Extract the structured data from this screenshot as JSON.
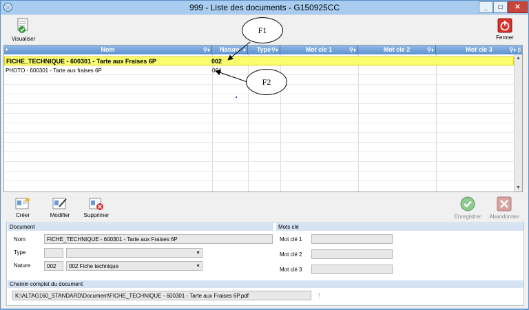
{
  "window": {
    "title": "999 - Liste des documents - G150925CC"
  },
  "toolbar_top": {
    "visualiser": "Visualiser",
    "fermer": "Fermer"
  },
  "grid": {
    "columns": [
      "Nom",
      "Nature",
      "Type",
      "Mot cle 1",
      "Mot cle 2",
      "Mot cle 3"
    ],
    "rows": [
      {
        "nom": "FICHE_TECHNIQUE - 600301 - Tarte aux Fraises 6P",
        "nature": "002",
        "selected": true
      },
      {
        "nom": "PHOTO - 600301 - Tarte aux fraises 6P",
        "nature": "004",
        "selected": false
      }
    ]
  },
  "annotations": {
    "f1": "F1",
    "f2": "F2"
  },
  "toolbar_bottom": {
    "creer": "Créer",
    "modifier": "Modifier",
    "supprimer": "Supprimer",
    "enregistrer": "Enregistrer",
    "abandonner": "Abandonner"
  },
  "form": {
    "document_title": "Document",
    "nom_label": "Nom",
    "nom_value": "FICHE_TECHNIQUE - 600301 - Tarte aux Fraises 6P",
    "type_label": "Type",
    "type_code": "",
    "type_value": "",
    "nature_label": "Nature",
    "nature_code": "002",
    "nature_value": "002  Fiche technique",
    "motscle_title": "Mots clé",
    "motcle1_label": "Mot clé 1",
    "motcle2_label": "Mot clé 2",
    "motcle3_label": "Mot clé 3",
    "motcle1_value": "",
    "motcle2_value": "",
    "motcle3_value": "",
    "chemin_title": "Chemin complet du document",
    "chemin_value": "K:\\ALTAG160_STANDARD\\Document\\FICHE_TECHNIQUE - 600301 - Tarte aux Fraises 6P.pdf"
  },
  "colors": {
    "title_bar": "#a9cdf0",
    "grid_header": "#5e92cf",
    "selected_row": "#fafd6e",
    "close_red": "#c7453b"
  },
  "icons": [
    "app-icon",
    "visualiser-icon",
    "fermer-icon",
    "creer-icon",
    "modifier-icon",
    "supprimer-icon",
    "enregistrer-icon",
    "abandonner-icon",
    "key-icon"
  ]
}
